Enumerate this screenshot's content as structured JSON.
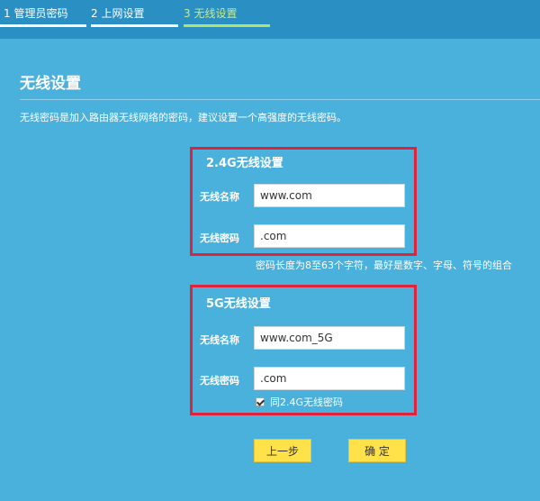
{
  "steps": [
    {
      "label": "1 管理员密码"
    },
    {
      "label": "2 上网设置"
    },
    {
      "label": "3 无线设置"
    }
  ],
  "page": {
    "title": "无线设置",
    "description": "无线密码是加入路由器无线网络的密码，建议设置一个高强度的无线密码。"
  },
  "band24": {
    "title": "2.4G无线设置",
    "ssid_label": "无线名称",
    "ssid_value": "www.com",
    "password_label": "无线密码",
    "password_value": ".com",
    "hint": "密码长度为8至63个字符，最好是数字、字母、符号的组合"
  },
  "band5": {
    "title": "5G无线设置",
    "ssid_label": "无线名称",
    "ssid_value": "www.com_5G",
    "password_label": "无线密码",
    "password_value": ".com",
    "same_password_label": "同2.4G无线密码"
  },
  "buttons": {
    "prev_label": "上一步",
    "confirm_label": "确 定"
  },
  "colors": {
    "background": "#4ab0dc",
    "topbar": "#2a8fc2",
    "highlight_border": "#e0233a",
    "button": "#ffe14a",
    "active_step": "#b6e06a"
  }
}
